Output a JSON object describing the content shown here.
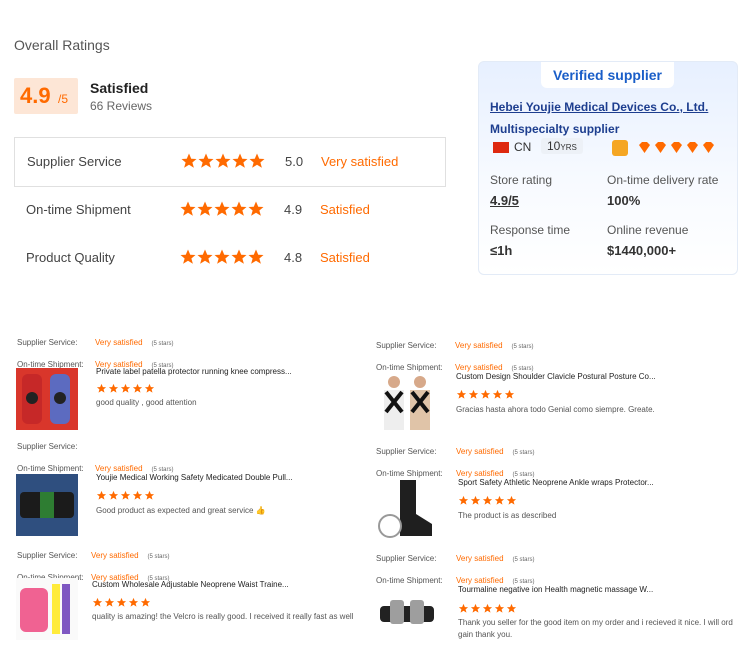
{
  "overall": {
    "title": "Overall Ratings",
    "score": "4.9",
    "score_suffix": "/5",
    "label": "Satisfied",
    "reviews": "66 Reviews"
  },
  "ratings": [
    {
      "label": "Supplier Service",
      "value": "5.0",
      "word": "Very satisfied",
      "stars": 5
    },
    {
      "label": "On-time Shipment",
      "value": "4.9",
      "word": "Satisfied",
      "stars": 5
    },
    {
      "label": "Product Quality",
      "value": "4.8",
      "word": "Satisfied",
      "stars": 5
    }
  ],
  "supplier": {
    "badge": "Verified supplier",
    "company": "Hebei Youjie Medical Devices Co., Ltd.",
    "type": "Multispecialty supplier",
    "country": "CN",
    "years": "10",
    "years_unit": "YRS",
    "store_rating_label": "Store rating",
    "store_rating": "4.9/5",
    "delivery_label": "On-time delivery rate",
    "delivery": "100%",
    "response_label": "Response time",
    "response": "≤1h",
    "revenue_label": "Online revenue",
    "revenue": "$1440,000+"
  },
  "colors": {
    "accent": "#ff6a00",
    "brand": "#1d3e8f"
  },
  "review_common": {
    "service_label": "Supplier Service:",
    "shipment_label": "On-time Shipment:",
    "very_satisfied": "Very satisfied",
    "satisfied": "Very satisfied",
    "five_stars": "(5 stars)"
  },
  "reviews": [
    {
      "title": "Private label patella protector running knee compress...",
      "text": "good quality , good attention"
    },
    {
      "title": "Youjie Medical Working Safety Medicated Double Pull...",
      "text": "Good product as expected and great service 👍"
    },
    {
      "title": "Custom Wholesale Adjustable Neoprene Waist Traine...",
      "text": "quality is amazing! the Velcro is really good. I received it really fast as well"
    },
    {
      "title": "Custom Design Shoulder Clavicle Postural Posture Co...",
      "text": "Gracias hasta ahora todo Genial como siempre. Greate."
    },
    {
      "title": "Sport Safety Athletic Neoprene Ankle wraps Protector...",
      "text": "The product is as described"
    },
    {
      "title": "Tourmaline negative ion Health magnetic massage W...",
      "text": "Thank you seller for the good item on my order and i recieved it nice. I will ord",
      "text2": "gain thank you."
    }
  ]
}
